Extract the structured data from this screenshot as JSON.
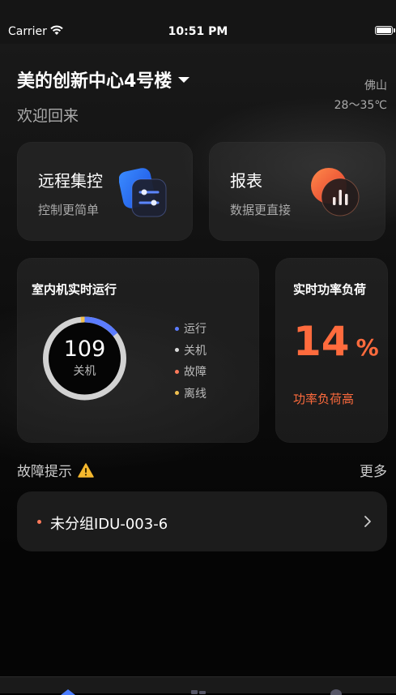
{
  "status_bar": {
    "carrier": "Carrier",
    "time": "10:51 PM"
  },
  "header": {
    "building": "美的创新中心4号楼",
    "welcome": "欢迎回来",
    "city": "佛山",
    "temperature": "28～35℃"
  },
  "quick_cards": [
    {
      "title": "远程集控",
      "subtitle": "控制更简单",
      "icon": "sliders-icon"
    },
    {
      "title": "报表",
      "subtitle": "数据更直接",
      "icon": "bar-chart-icon"
    }
  ],
  "indoor_units": {
    "title": "室内机实时运行",
    "count": "109",
    "count_label": "关机",
    "legend": [
      {
        "label": "运行",
        "color": "#5b7cff"
      },
      {
        "label": "关机",
        "color": "#d9d9d9"
      },
      {
        "label": "故障",
        "color": "#ff7a5a"
      },
      {
        "label": "离线",
        "color": "#f0c050"
      }
    ]
  },
  "power_load": {
    "title": "实时功率负荷",
    "value": "14",
    "unit": "%",
    "status": "功率负荷高",
    "accent": "#ff6b3d"
  },
  "fault_section": {
    "title": "故障提示",
    "more": "更多",
    "items": [
      {
        "name": "未分组IDU-003-6"
      }
    ]
  }
}
